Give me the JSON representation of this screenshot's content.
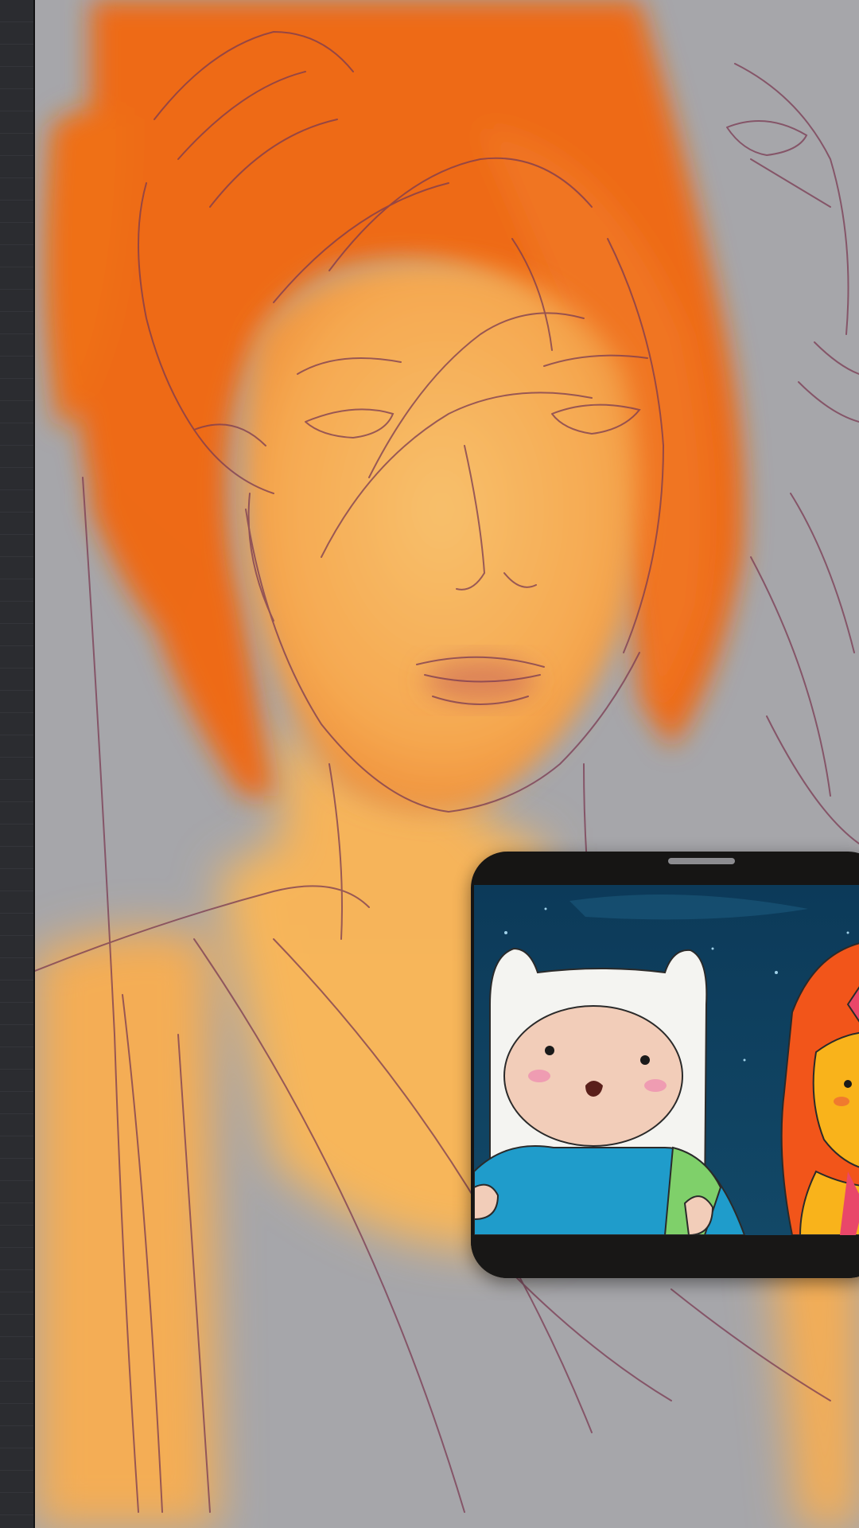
{
  "app": {
    "mode": "drawing-canvas",
    "colors": {
      "canvas_background": "#a6a6aa",
      "rail_background": "#26272b",
      "hair_orange": "#ee6a14",
      "skin_yellow": "#f7b65a",
      "sketch_line": "#7a3a52",
      "pip_frame": "#161514"
    }
  },
  "toolbar": {
    "icon": "ruler-strip"
  },
  "pip": {
    "icon": "video-reference-window",
    "grabber_icon": "drag-handle-icon"
  }
}
